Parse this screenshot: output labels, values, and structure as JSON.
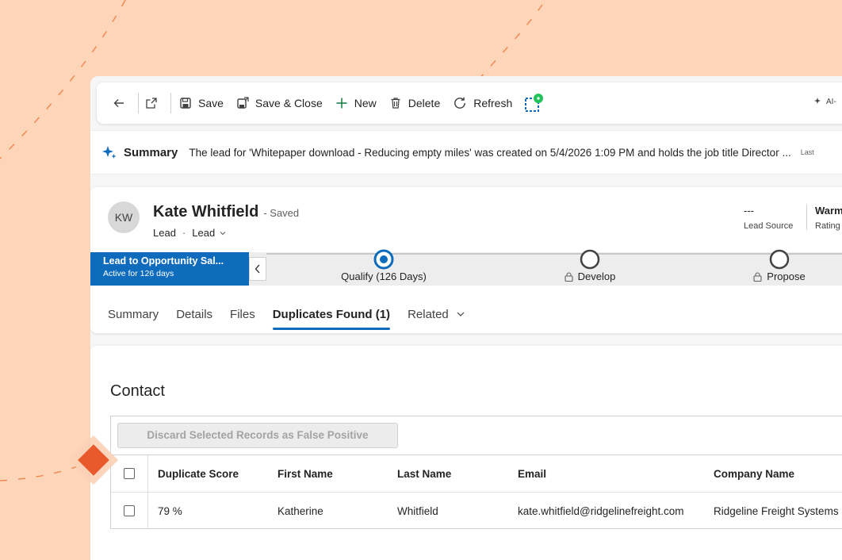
{
  "colors": {
    "background": "#fdd5b8",
    "accent": "#0f6cbd",
    "diamond": "#e8592b",
    "copilot_badge": "#21c35a"
  },
  "toolbar": {
    "back_icon": "arrow-left-icon",
    "popout_icon": "open-in-new-window-icon",
    "save_label": "Save",
    "save_close_label": "Save & Close",
    "new_label": "New",
    "delete_label": "Delete",
    "refresh_label": "Refresh",
    "ai_label": "AI-"
  },
  "summary": {
    "title": "Summary",
    "text": "The lead for 'Whitepaper download - Reducing empty miles' was created on 5/4/2026 1:09 PM and holds the job title Director ...",
    "last_label": "Last"
  },
  "record": {
    "initials": "KW",
    "name": "Kate Whitfield",
    "status": "- Saved",
    "entity": "Lead",
    "separator": "·",
    "form": "Lead",
    "header_fields": [
      {
        "value": "---",
        "label": "Lead Source"
      },
      {
        "value": "Warm",
        "label": "Rating"
      }
    ]
  },
  "bpf": {
    "process_name": "Lead to Opportunity Sal...",
    "active_for": "Active for 126 days",
    "stages": [
      {
        "label": "Qualify  (126 Days)",
        "state": "active"
      },
      {
        "label": "Develop",
        "state": "locked"
      },
      {
        "label": "Propose",
        "state": "locked"
      }
    ]
  },
  "tabs": [
    {
      "label": "Summary"
    },
    {
      "label": "Details"
    },
    {
      "label": "Files"
    },
    {
      "label": "Duplicates Found (1)"
    },
    {
      "label": "Related"
    }
  ],
  "duplicates": {
    "section_title": "Contact",
    "discard_label": "Discard Selected Records as False Positive",
    "columns": [
      "Duplicate Score",
      "First Name",
      "Last Name",
      "Email",
      "Company Name"
    ],
    "rows": [
      {
        "score": "79 %",
        "first_name": "Katherine",
        "last_name": "Whitfield",
        "email": "kate.whitfield@ridgelinefreight.com",
        "company": "Ridgeline Freight Systems"
      }
    ]
  }
}
